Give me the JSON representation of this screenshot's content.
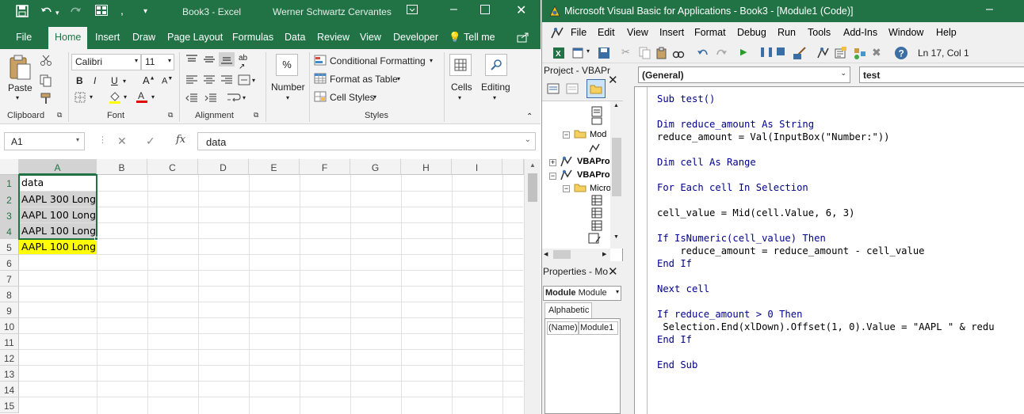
{
  "excel": {
    "title": "Book3  -  Excel",
    "user": "Werner Schwartz Cervantes",
    "tabs": [
      "File",
      "Home",
      "Insert",
      "Draw",
      "Page Layout",
      "Formulas",
      "Data",
      "Review",
      "View",
      "Developer"
    ],
    "active_tab": "Home",
    "tell_me": "Tell me",
    "ribbon": {
      "paste": "Paste",
      "clipboard": "Clipboard",
      "font_name": "Calibri",
      "font_size": "11",
      "font": "Font",
      "alignment": "Alignment",
      "number": "Number",
      "conditional_formatting": "Conditional Formatting",
      "format_as_table": "Format as Table",
      "cell_styles": "Cell Styles",
      "styles": "Styles",
      "cells": "Cells",
      "editing": "Editing"
    },
    "name_box": "A1",
    "formula": "data",
    "columns": [
      "A",
      "B",
      "C",
      "D",
      "E",
      "F",
      "G",
      "H",
      "I"
    ],
    "rows": [
      "1",
      "2",
      "3",
      "4",
      "5",
      "6",
      "7",
      "8",
      "9",
      "10",
      "11",
      "12",
      "13",
      "14",
      "15"
    ],
    "cells": [
      "data",
      "AAPL 300 Long",
      "AAPL 100 Long",
      "AAPL 100 Long",
      "AAPL 100 Long"
    ],
    "highlight_color": "#ffff00",
    "accent": "#217346"
  },
  "vba": {
    "title": "Microsoft Visual Basic for Applications - Book3 - [Module1 (Code)]",
    "menu": [
      "File",
      "Edit",
      "View",
      "Insert",
      "Format",
      "Debug",
      "Run",
      "Tools",
      "Add-Ins",
      "Window",
      "Help"
    ],
    "status": "Ln 17, Col 1",
    "project_title": "Project - VBAPr",
    "tree": [
      "Mod",
      "VBAPro",
      "VBAPro",
      "Micro"
    ],
    "properties_title": "Properties - Mo",
    "properties_object": "Module",
    "properties_object_type": "Module",
    "properties_tab": "Alphabetic",
    "prop_name_key": "(Name)",
    "prop_name_value": "Module1",
    "general_combo": "(General)",
    "proc_combo": "test",
    "code": [
      "Sub test()",
      "",
      "Dim reduce_amount As String",
      "reduce_amount = Val(InputBox(\"Number:\"))",
      "",
      "Dim cell As Range",
      "",
      "For Each cell In Selection",
      "",
      "cell_value = Mid(cell.Value, 6, 3)",
      "",
      "If IsNumeric(cell_value) Then",
      "    reduce_amount = reduce_amount - cell_value",
      "End If",
      "",
      "Next cell",
      "",
      "If reduce_amount > 0 Then",
      " Selection.End(xlDown).Offset(1, 0).Value = \"AAPL \" & redu",
      "End If",
      "",
      "End Sub"
    ]
  }
}
